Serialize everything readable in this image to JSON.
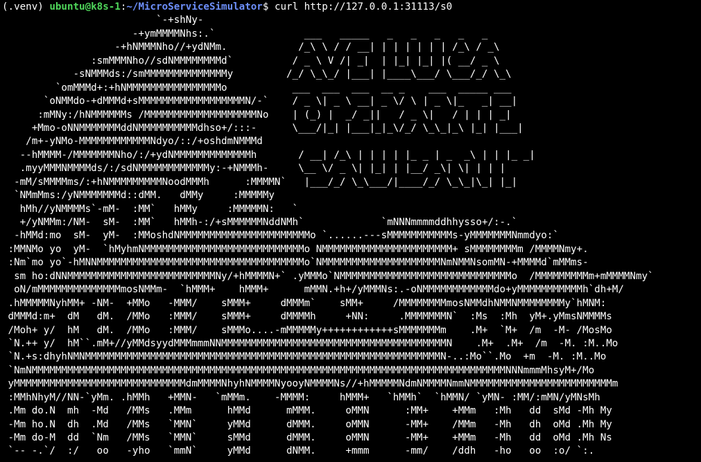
{
  "window": {
    "prompt": {
      "venv": "(.venv) ",
      "user_host": "ubuntu@k8s-1",
      "colon": ":",
      "path": "~/MicroServiceSimulator",
      "dollar": "$ ",
      "command": "curl http://127.0.0.1:31113/s0"
    }
  },
  "output": {
    "lines": [
      "                          `-+shNy-",
      "                      -+ymMMMMNhs:.`               ___   _____   _   _   _   _   _",
      "                   -+hNMMMNho//+ydNMm.            /_\\ \\ / / __| | | | | | | /_\\ / _\\",
      "               :smMMMNho//sdNMMMMMMMMd`          / _ \\ V /| _|  | |_| |_| |( __/ _ \\",
      "            -sNMMMds:/smMMMMMMMMMMMMMMy         /_/ \\_\\_/ |___| |____\\___/ \\___/_/ \\_\\",
      "         `omMMMd+:+hNMMMMMMMMMMMMMMMMo           ___  ___  ___  __ _    ___  _____ ___",
      "       `oNMMdo-+dMMMd+sMMMMMMMMMMMMMMMMMMN/-`    / _ \\| _ \\ __| _ \\/ \\ | _ \\|_   _| __|",
      "      :mMNy:/hNMMMMMMs /MMMMMMMMMMMMMMMMMMMNo    | (_) |  _/ _||   / _ \\|   / | | | _|",
      "     +Mmo-oNNMMMMMMMddNMMMMMMMMMMdhso+/:::-      \\___/|_| |___|_|_\\/_/ \\_\\_|_\\ |_| |___|",
      "    /m+-yNMo-MMMMMMMMMMMMNdyo/::/+oshdmNMMMd",
      "   --hMMMM-/MMMMMMMNho/:/+ydNMMMMMMMMMMMMMh       / __| /_\\ | | | | |_ _ | _  _\\ | | |_ _|",
      "   .myyMMMNMMMMds/:/sdNMMMMMMMMMMMMy:-+NMMMh-     \\__ \\/ _ \\| |_| | |__/ _\\| \\| | | |",
      "  -mM/sMMMMms/:+hNMMMMMMMMMNoodMMMh      :MMMMN`   |___/_/ \\_\\___/|____/_/ \\_\\_|\\_| |_|",
      "  `NMmMms:/yNMMMMMMMd::dMM.   dMMy     :MMMMMy",
      "   hMh//yNMMMMs`-mM-  :MM`   hMMy     :MMMMMN:   `",
      "   +/yNMMm:/NM-  sM-  :MM`   hMMh-:/+sMMMMMMNddNMh`             `mNNNmmmmddhhysso+/:-.`",
      "  -hMMd:mo  sM-  yM-  :MMoshdNMMMMMMMMMMMMMMMMMMMMMMo `......---sMMMMMMMMMMMs-yMMMMMMMNmmdyo:`",
      " :MMNMo yo  yM-  `hMyhmNMMMMMMMMMMMMMMMMMMMMMMMMMMMo NMMMMMMMMMMMMMMMMMMMMMM+ sMMMMMMMMm /MMMMNmy+.",
      " :Nm`mo yo`-hMNNMMMMMMMMMMMMMMMMMMMMMMMMMMMMMMMMMMMo`NMMMMMMMMMMMMMMMMMMMMNmNMMNsomMN-+MMMMd`mMMms-",
      "  sm ho:dNNMMMMMMMMMMMMMMMMMMMMMMMMMNy/+hMMMMN+` .yMMMo`NMMMMMMMMMMMMMMMMMMMMMMMMMMMMMo  /MMMMMMMMMm+mMMMMNmy`",
      "  oN/mMMMMMMMMMMMMMMmosNMMm-  `hMMM+    hMMM+      mMMN.+h+/yMMMNs:.-oNMMMMMMMMMMMMdo+yMMMMMMMMMMMh`dh+M/",
      " .hMMMMMNyhMM+ -NM-  +MMo   -MMM/    sMMM+     dMMMm`    sMM+     /MMMMMMMMmosNMMdhNMMNMMMMMMMMy`hMNM:",
      " dMMMd:m+  dM   dM.  /MMo   :MMM/    sMMM+     dMMMMh     +NN:     .MMMMMMMN`  :Ms  :Mh  yM+.yMmsNMMMMs",
      " /Moh+ y/  hM   dM.  /MMo   :MMM/    sMMMo....-mMMMMMy++++++++++++sMMMMMMMm    .M+  `M+  /m  -M- /MosMo",
      " `N.++ y/  hM``.mM+//yMMdsyydMMMmmmNNMMMMMMMMMMMMMMMMMMMMMMMMMMMMMMMMMMMMMMN    .M+  .M+  /m  -M. :M..Mo",
      " `N.+s:dhyhNMNMMMMMMMMMMMMMMMMMMMMMMMMMMMMMMMMMMMMMMMMMMMMMMMMMMMMMMMMMMMMN-..:Mo``.Mo  +m  -M. :M..Mo",
      " `NmNMMMMMMMMMMMMMMMMMMMMMMMMMMMMMMMMMMMMMMMMMMMMMMMMMMMMMMMMMMMMMMMMMMMMMMMMMMMMMMMMNNNmmmMhsyM+/Mo",
      " yMMMMMMMMMMMMMMMMMMMMMMMMMMMMMdmMMMMNhyhNMMMMNyooyNMMMMNs//+hMMMMMNdmNMMMMNmmNMMMMMMMMMMMMMMMMMMMMMMMMm",
      " :MMhNhyM//NN-`yMm. .hMMh   +MMN-   `mMMm.    -MMMM:     hMMM+   `hMMh`  `hMMN/ `yMN- :MM/:mMN/yMNsMh",
      " .Mm do.N  mh  -Md   /MMs   .MMm      hMMd      mMMM.     oMMN      :MM+    +MMm   :Mh   dd  sMd -Mh My",
      " -Mm ho.N  dh  .Md   /MMs   `MMN`     yMMd      dMMM.     oMMN      -MM+    /MMm   -Mh   dh  oMd .Mh My",
      " -Mm do-M  dd  `Nm   /MMs   `MMN`     sMMd      dMMM.     oMMN      -MM+    +MMm   -Mh   dd  oMd .Mh Ns",
      " `-- -.`/  :/   oo   -yho   `mmN`     yMMd      dNMM.     +mmm      -mm/    /ddh   -ho   oo  :o/ `:."
    ]
  }
}
